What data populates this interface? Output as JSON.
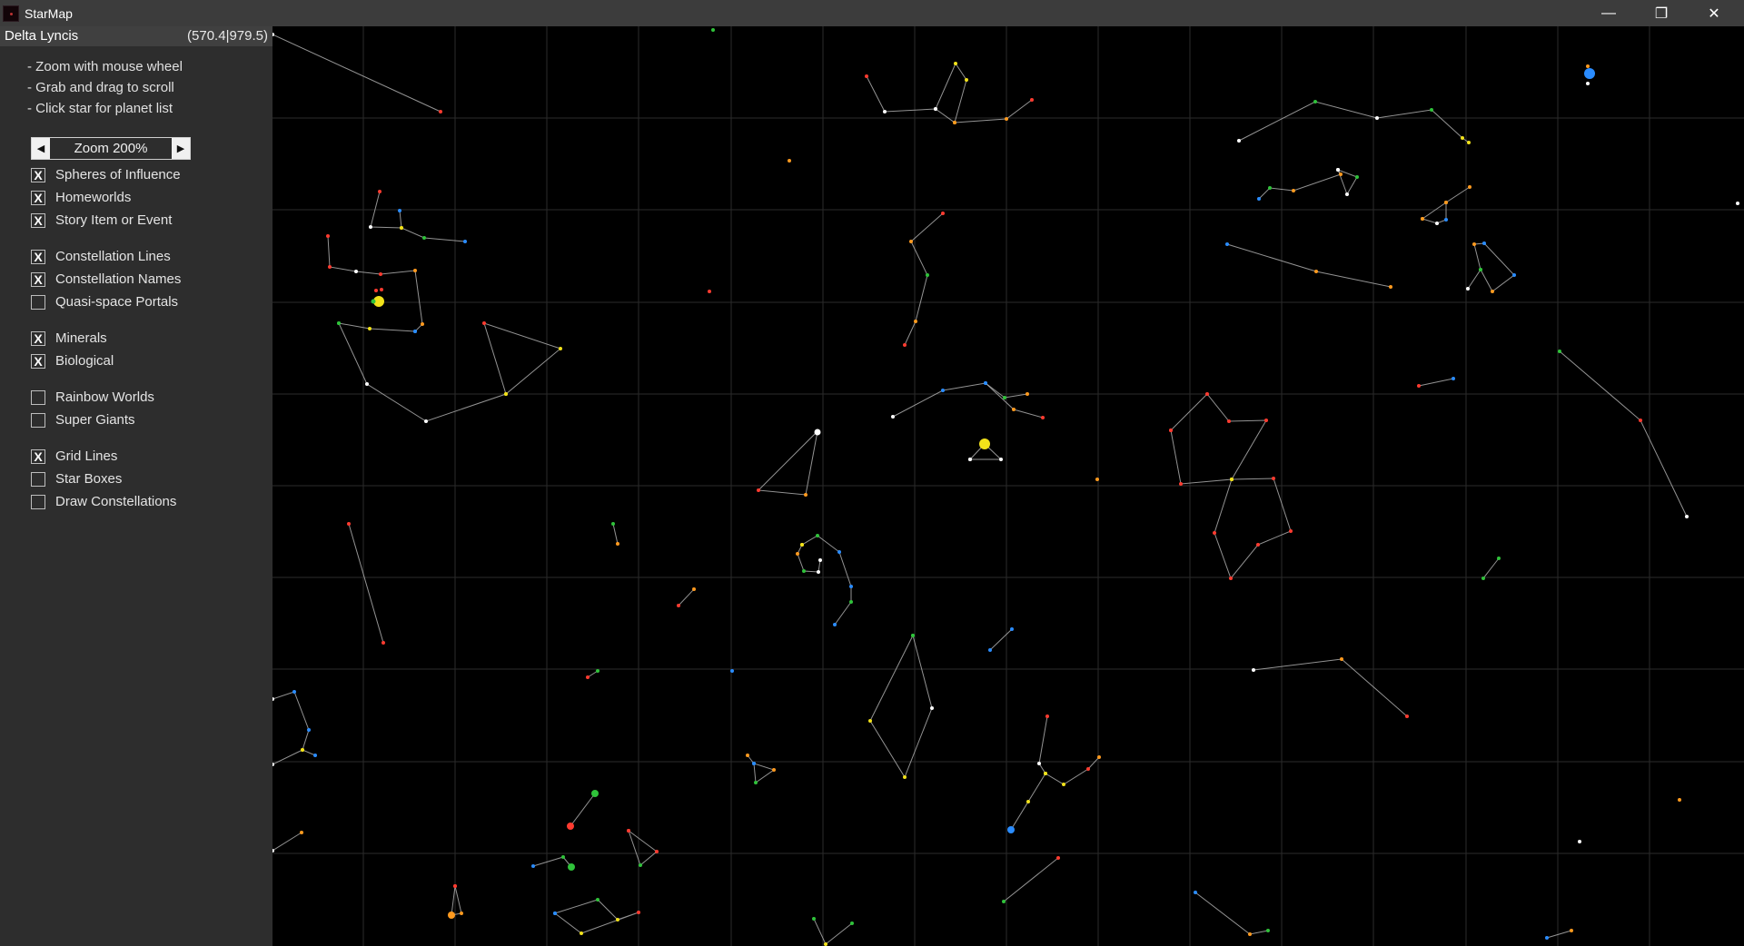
{
  "window": {
    "title": "StarMap",
    "minimize_glyph": "—",
    "maximize_glyph": "❐",
    "close_glyph": "✕"
  },
  "sidebar": {
    "star_name": "Delta Lyncis",
    "star_coords": "(570.4|979.5)",
    "help": [
      "- Zoom with mouse wheel",
      "- Grab and drag to scroll",
      "- Click star for planet list"
    ],
    "zoom": {
      "left_glyph": "◀",
      "label": "Zoom 200%",
      "right_glyph": "▶"
    },
    "options": [
      {
        "label": "Spheres of Influence",
        "checked": true
      },
      {
        "label": "Homeworlds",
        "checked": true
      },
      {
        "label": "Story Item or Event",
        "checked": true
      },
      {
        "label": "Constellation Lines",
        "checked": true
      },
      {
        "label": "Constellation Names",
        "checked": true
      },
      {
        "label": "Quasi-space Portals",
        "checked": false
      },
      {
        "label": "Minerals",
        "checked": true
      },
      {
        "label": "Biological",
        "checked": true
      },
      {
        "label": "Rainbow Worlds",
        "checked": false
      },
      {
        "label": "Super Giants",
        "checked": false
      },
      {
        "label": "Grid Lines",
        "checked": true
      },
      {
        "label": "Star Boxes",
        "checked": false
      },
      {
        "label": "Draw Constellations",
        "checked": false
      }
    ],
    "check_glyph": "X"
  },
  "colors": {
    "red": "#ff3b30",
    "orange": "#ff9a1f",
    "yellow": "#f2e21a",
    "green": "#2fc23a",
    "blue": "#2a8cff",
    "white": "#ffffff",
    "grid": "#2b2b2b",
    "lines": "#b8b8b8"
  }
}
